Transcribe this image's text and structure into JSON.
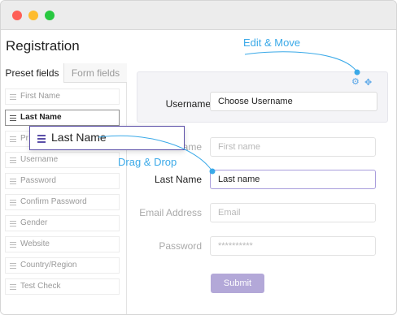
{
  "window": {
    "controls": [
      "close",
      "minimize",
      "maximize"
    ],
    "colors": {
      "close": "#fe5f57",
      "minimize": "#febc2e",
      "maximize": "#28c840"
    }
  },
  "page": {
    "title": "Registration"
  },
  "tabs": [
    {
      "label": "Preset fields",
      "active": true
    },
    {
      "label": "Form fields",
      "active": false
    }
  ],
  "preset_fields": [
    {
      "label": "First Name",
      "selected": false
    },
    {
      "label": "Last Name",
      "selected": true
    },
    {
      "label": "Pr",
      "selected": false
    },
    {
      "label": "Username",
      "selected": false
    },
    {
      "label": "Password",
      "selected": false
    },
    {
      "label": "Confirm Password",
      "selected": false
    },
    {
      "label": "Gender",
      "selected": false
    },
    {
      "label": "Website",
      "selected": false
    },
    {
      "label": "Country/Region",
      "selected": false
    },
    {
      "label": "Test Check",
      "selected": false
    }
  ],
  "form": {
    "username": {
      "label": "Username",
      "value": "Choose Username"
    },
    "first_name": {
      "label": "ame",
      "placeholder": "First name"
    },
    "last_name": {
      "label": "Last Name",
      "value": "Last name"
    },
    "email": {
      "label": "Email Address",
      "placeholder": "Email"
    },
    "password": {
      "label": "Password",
      "placeholder": "**********"
    },
    "submit_label": "Submit"
  },
  "drag_ghost": {
    "label": "Last Name",
    "icon": "drag-handle-icon"
  },
  "annotations": {
    "edit_move": "Edit & Move",
    "drag_drop": "Drag & Drop"
  },
  "colors": {
    "accent": "#3aa9e8",
    "purple": "#5b4fa8",
    "submit": "#b3a8d8"
  }
}
